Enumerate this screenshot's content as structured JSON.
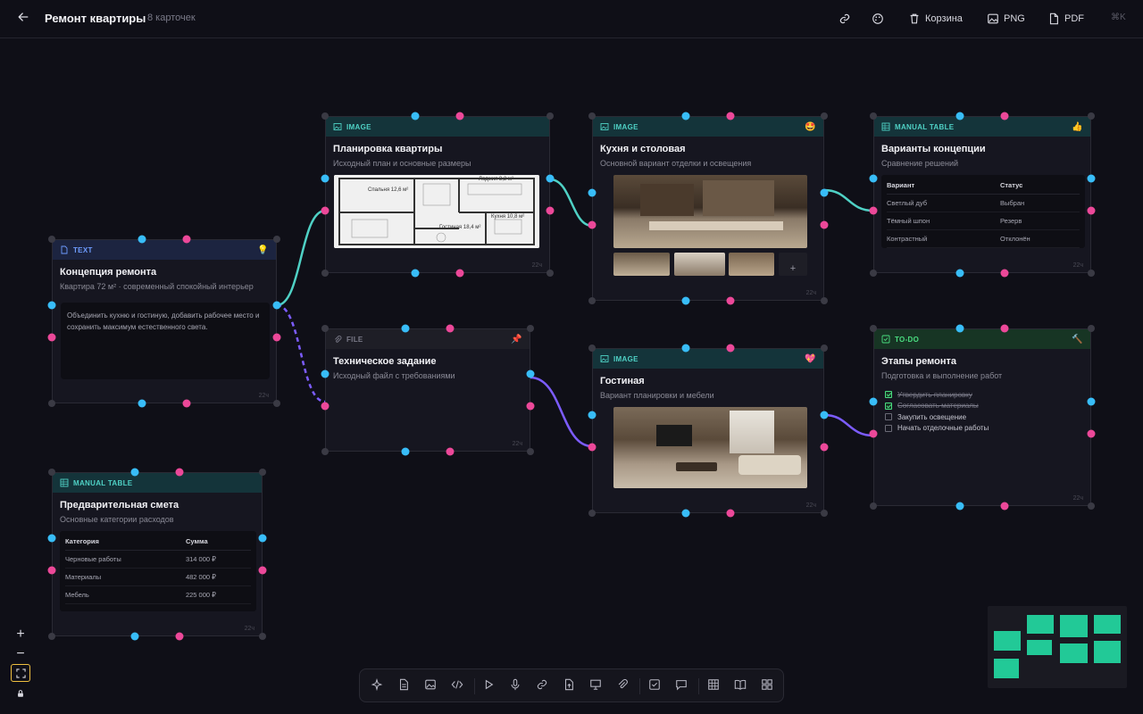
{
  "header": {
    "title": "Ремонт квартиры",
    "subtitle": "8 карточек",
    "trash_label": "Корзина",
    "png_label": "PNG",
    "pdf_label": "PDF",
    "shortcut": "⌘K"
  },
  "cards": {
    "concept": {
      "type": "TEXT",
      "emoji": "💡",
      "title": "Концепция ремонта",
      "desc": "Квартира 72 м² · современный спокойный интерьер",
      "body": "Объединить кухню и гостиную, добавить рабочее место и сохранить максимум естественного света.",
      "foot": "22ч"
    },
    "plan": {
      "type": "IMAGE",
      "title": "Планировка квартиры",
      "desc": "Исходный план и основные размеры",
      "rooms": [
        "Спальня 12,6 м²",
        "Лоджия 3,2 м²",
        "Кухня 10,8 м²",
        "Гостиная 18,4 м²"
      ],
      "foot": "22ч"
    },
    "kitchen": {
      "type": "IMAGE",
      "emoji": "🤩",
      "title": "Кухня и столовая",
      "desc": "Основной вариант отделки и освещения",
      "add_label": "+",
      "foot": "22ч"
    },
    "concepts": {
      "type": "MANUAL TABLE",
      "emoji": "👍",
      "title": "Варианты концепции",
      "desc": "Сравнение решений",
      "columns": [
        "Вариант",
        "Статус"
      ],
      "rows": [
        [
          "Светлый дуб",
          "Выбран"
        ],
        [
          "Тёмный шпон",
          "Резерв"
        ],
        [
          "Контрастный",
          "Отклонён"
        ]
      ],
      "foot": "22ч"
    },
    "spec": {
      "type": "FILE",
      "emoji": "📌",
      "title": "Техническое задание",
      "desc": "Исходный файл с требованиями",
      "foot": "22ч"
    },
    "living": {
      "type": "IMAGE",
      "emoji": "💖",
      "title": "Гостиная",
      "desc": "Вариант планировки и мебели",
      "foot": "22ч"
    },
    "stages": {
      "type": "TO-DO",
      "emoji": "🔨",
      "title": "Этапы ремонта",
      "desc": "Подготовка и выполнение работ",
      "items": [
        {
          "label": "Утвердить планировку",
          "done": true
        },
        {
          "label": "Согласовать материалы",
          "done": true
        },
        {
          "label": "Закупить освещение",
          "done": false
        },
        {
          "label": "Начать отделочные работы",
          "done": false
        }
      ],
      "foot": "22ч"
    },
    "estimate": {
      "type": "MANUAL TABLE",
      "title": "Предварительная смета",
      "desc": "Основные категории расходов",
      "columns": [
        "Категория",
        "Сумма"
      ],
      "rows": [
        [
          "Черновые работы",
          "314 000 ₽"
        ],
        [
          "Материалы",
          "482 000 ₽"
        ],
        [
          "Мебель",
          "225 000 ₽"
        ]
      ],
      "foot": "22ч"
    }
  },
  "colors": {
    "teal": "#4fd1c5",
    "purple": "#7c5cff",
    "port_cyan": "#38bdf8",
    "port_pink": "#ec4899",
    "minimap": "#22c997"
  },
  "zoom": {
    "plus": "+",
    "minus": "−"
  }
}
